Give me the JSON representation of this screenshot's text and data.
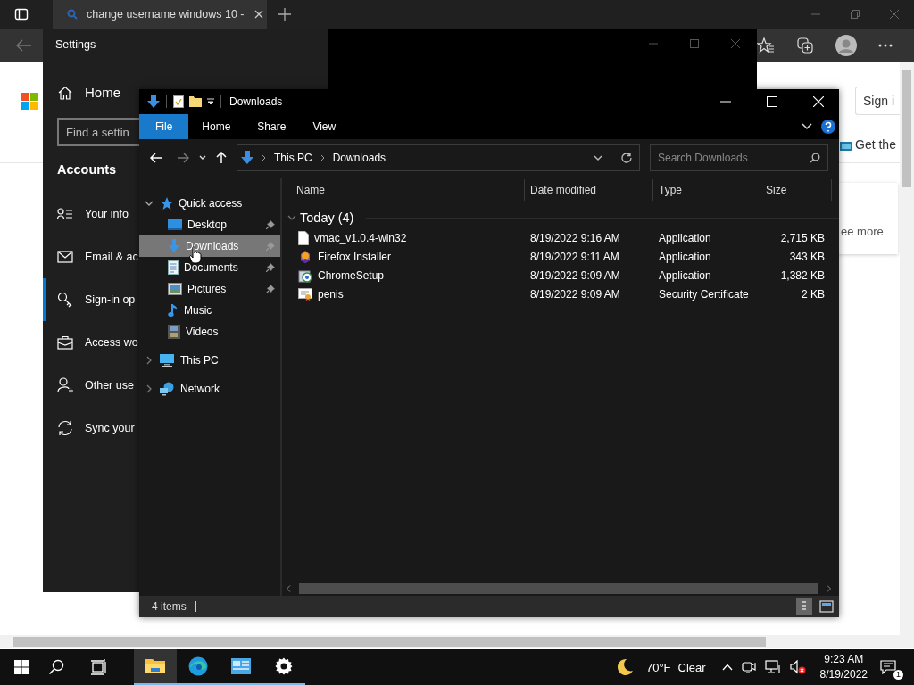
{
  "browser": {
    "tab_title": "change username windows 10 -",
    "sign_in_button": "Sign i",
    "get_app_link": "Get the",
    "see_more_link": "ee more"
  },
  "settings": {
    "title": "Settings",
    "home": "Home",
    "search": {
      "placeholder": "Find a settin"
    },
    "section": "Accounts",
    "items": [
      {
        "label": "Your info",
        "kind": "person-list",
        "selected": false
      },
      {
        "label": "Email & ac",
        "kind": "mail",
        "selected": false
      },
      {
        "label": "Sign-in op",
        "kind": "key",
        "selected": true
      },
      {
        "label": "Access wo",
        "kind": "briefcase",
        "selected": false
      },
      {
        "label": "Other use",
        "kind": "person-add",
        "selected": false
      },
      {
        "label": "Sync your",
        "kind": "sync",
        "selected": false
      }
    ]
  },
  "explorer": {
    "title": "Downloads",
    "ribbon_tabs": [
      {
        "label": "File",
        "selected": true
      },
      {
        "label": "Home",
        "selected": false
      },
      {
        "label": "Share",
        "selected": false
      },
      {
        "label": "View",
        "selected": false
      }
    ],
    "address": [
      "This PC",
      "Downloads"
    ],
    "search": {
      "placeholder": "Search Downloads"
    },
    "nav": [
      {
        "label": "Quick access",
        "kind": "star",
        "expanded": true,
        "children": [
          {
            "label": "Desktop",
            "kind": "desktop",
            "pinned": true,
            "selected": false
          },
          {
            "label": "Downloads",
            "kind": "download",
            "pinned": true,
            "selected": true
          },
          {
            "label": "Documents",
            "kind": "document",
            "pinned": true,
            "selected": false
          },
          {
            "label": "Pictures",
            "kind": "pictures",
            "pinned": true,
            "selected": false
          },
          {
            "label": "Music",
            "kind": "music",
            "pinned": false,
            "selected": false
          },
          {
            "label": "Videos",
            "kind": "videos",
            "pinned": false,
            "selected": false
          }
        ]
      },
      {
        "label": "This PC",
        "kind": "computer",
        "expanded": false
      },
      {
        "label": "Network",
        "kind": "network",
        "expanded": false
      }
    ],
    "columns": [
      "Name",
      "Date modified",
      "Type",
      "Size"
    ],
    "group": {
      "label": "Today (4)",
      "expanded": true
    },
    "files": [
      {
        "name": "vmac_v1.0.4-win32",
        "date": "8/19/2022 9:16 AM",
        "type": "Application",
        "size": "2,715 KB",
        "kind": "blank"
      },
      {
        "name": "Firefox Installer",
        "date": "8/19/2022 9:11 AM",
        "type": "Application",
        "size": "343 KB",
        "kind": "installer"
      },
      {
        "name": "ChromeSetup",
        "date": "8/19/2022 9:09 AM",
        "type": "Application",
        "size": "1,382 KB",
        "kind": "setup"
      },
      {
        "name": "penis",
        "date": "8/19/2022 9:09 AM",
        "type": "Security Certificate",
        "size": "2 KB",
        "kind": "certificate"
      }
    ],
    "status": "4 items"
  },
  "taskbar": {
    "apps": [
      {
        "kind": "explorer",
        "selected": true,
        "running": true
      },
      {
        "kind": "edge",
        "selected": false,
        "running": true
      },
      {
        "kind": "control",
        "selected": false,
        "running": true
      },
      {
        "kind": "settings",
        "selected": false,
        "running": true
      }
    ],
    "temperature": "70°F",
    "condition": "Clear",
    "time": "9:23 AM",
    "date": "8/19/2022",
    "notifications": "1"
  }
}
